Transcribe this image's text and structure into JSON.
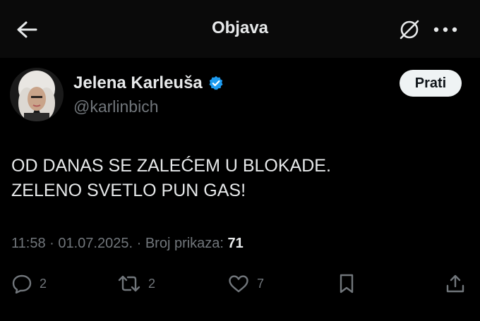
{
  "header": {
    "title": "Objava",
    "back_icon": "arrow-left-icon",
    "grok_icon": "grok-icon",
    "more_icon": "more-dots-icon"
  },
  "author": {
    "name": "Jelena Karleuša",
    "handle": "@karlinbich",
    "verified": true,
    "verified_color": "#1d9bf0"
  },
  "follow_button": {
    "label": "Prati"
  },
  "tweet": {
    "lines": [
      "OD DANAS SE ZALEĆEM U BLOKADE.",
      "ZELENO SVETLO PUN GAS!"
    ]
  },
  "meta": {
    "time": "11:58",
    "date": "01.07.2025.",
    "separator": "·",
    "views_label": "Broj prikaza:",
    "views_count": "71"
  },
  "actions": {
    "replies": "2",
    "reposts": "2",
    "likes": "7"
  },
  "colors": {
    "background": "#000000",
    "header_background": "#0a0a0a",
    "text": "#e7e9ea",
    "muted": "#71767b",
    "follow_bg": "#eff3f4"
  }
}
